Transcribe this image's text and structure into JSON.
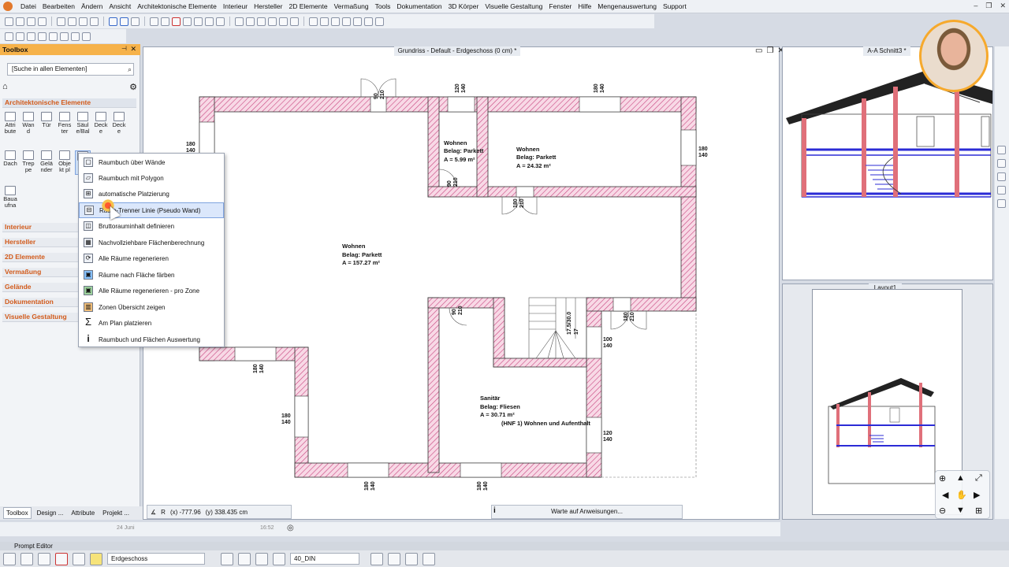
{
  "menu": [
    "Datei",
    "Bearbeiten",
    "Ändern",
    "Ansicht",
    "Architektonische Elemente",
    "Interieur",
    "Hersteller",
    "2D Elemente",
    "Vermaßung",
    "Tools",
    "Dokumentation",
    "3D Körper",
    "Visuelle Gestaltung",
    "Fenster",
    "Hilfe",
    "Mengenauswertung",
    "Support"
  ],
  "toolbox": {
    "title": "Toolbox",
    "search_placeholder": "[Suche in allen Elementen]",
    "category_active": "Architektonische Elemente",
    "tools": [
      {
        "label": "Attri\nbute"
      },
      {
        "label": "Wan\nd"
      },
      {
        "label": "Tür"
      },
      {
        "label": "Fens\nter"
      },
      {
        "label": "Säul\ne/Bal"
      },
      {
        "label": "Deck\ne"
      },
      {
        "label": "Deck\ne"
      },
      {
        "label": "Dach"
      },
      {
        "label": "Trep\npe"
      },
      {
        "label": "Gelä\nnder"
      },
      {
        "label": "Obje\nkt pl"
      },
      {
        "label": "R\nm"
      },
      {
        "label": "Baua\nufna"
      }
    ],
    "categories": [
      "Interieur",
      "Hersteller",
      "2D Elemente",
      "Vermaßung",
      "Gelände",
      "Dokumentation",
      "Visuelle Gestaltung"
    ]
  },
  "popup": {
    "items": [
      {
        "label": "Raumbuch über Wände",
        "icon": "room-walls-icon"
      },
      {
        "label": "Raumbuch mit Polygon",
        "icon": "room-polygon-icon"
      },
      {
        "label": "automatische Platzierung",
        "icon": "auto-place-icon"
      },
      {
        "label": "Raum-Trenner Linie (Pseudo Wand)",
        "icon": "pseudo-wall-icon"
      },
      {
        "label": "Bruttorauminhalt definieren",
        "icon": "gross-volume-icon"
      },
      {
        "label": "Nachvollziehbare Flächenberechnung",
        "icon": "area-calc-icon"
      },
      {
        "label": "Alle Räume regenerieren",
        "icon": "regenerate-icon"
      },
      {
        "label": "Räume nach Fläche färben",
        "icon": "color-rooms-icon"
      },
      {
        "label": "Alle Räume regenerieren - pro Zone",
        "icon": "regenerate-zone-icon"
      },
      {
        "label": "Zonen Übersicht zeigen",
        "icon": "zones-overview-icon"
      },
      {
        "label": "Am Plan platzieren",
        "icon": "sum-icon"
      },
      {
        "label": "Raumbuch und Flächen Auswertung",
        "icon": "info-icon"
      }
    ],
    "highlighted_index": 3
  },
  "drawing": {
    "title": "Grundriss - Default - Erdgeschoss (0 cm) *",
    "rooms": [
      {
        "name": "Wohnen",
        "belag": "Belag:  Parkett",
        "area": "A =     5.99 m²"
      },
      {
        "name": "Wohnen",
        "belag": "Belag:  Parkett",
        "area": "A =     24.32 m²"
      },
      {
        "name": "Wohnen",
        "belag": "Belag:  Parkett",
        "area": "A =     157.27 m²"
      },
      {
        "name": "Sanitär",
        "belag": "Belag:  Fliesen",
        "area": "A =     30.71 m²",
        "note": "(HNF 1) Wohnen und Aufenthalt"
      }
    ],
    "dims": [
      "180\n140",
      "120\n140",
      "90\n210",
      "180\n210",
      "17.5/30.0",
      "17",
      "100\n140",
      "120\n140"
    ]
  },
  "section_title": "A-A Schnitt3 *",
  "layout_title": "Layout1",
  "tabs": [
    "Toolbox",
    "Design ...",
    "Attribute",
    "Projekt ..."
  ],
  "coords": {
    "x": "(x) -777.96",
    "y": "(y) 338.435 cm"
  },
  "status": "Warte auf Anweisungen...",
  "timeline": {
    "date": "24 Juni",
    "time": "16:52"
  },
  "prompt_editor": "Prompt Editor",
  "bottom": {
    "floor": "Erdgeschoss",
    "pen": "40_DIN"
  }
}
